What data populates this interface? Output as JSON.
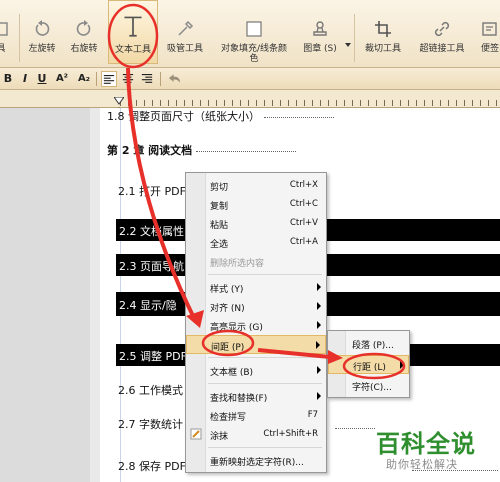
{
  "toolbar": {
    "items": [
      {
        "label": "具",
        "icon": "tool-icon"
      },
      {
        "label": "左旋转",
        "icon": "rotate-left-icon"
      },
      {
        "label": "右旋转",
        "icon": "rotate-right-icon"
      },
      {
        "label": "文本工具",
        "icon": "text-tool-icon"
      },
      {
        "label": "吸管工具",
        "icon": "eyedropper-icon"
      },
      {
        "label": "对象填充/线条颜",
        "label2": "色",
        "icon": "fill-color-icon"
      },
      {
        "label": "图章 (S)",
        "icon": "stamp-icon"
      },
      {
        "label": "裁切工具",
        "icon": "crop-icon"
      },
      {
        "label": "超链接工具",
        "icon": "hyperlink-icon"
      },
      {
        "label": "便签",
        "icon": "note-icon"
      }
    ]
  },
  "formatbar": {
    "bold": "B",
    "italic": "I",
    "underline": "U",
    "superscript": "A²",
    "subscript": "A₂"
  },
  "document": {
    "lines": [
      {
        "text": "1.8 调整页面尺寸（纸张大小）"
      },
      {
        "text": "第 2 章  阅读文档"
      },
      {
        "text": "2.1 打开 PDF"
      },
      {
        "text": "2.2 文档属性"
      },
      {
        "text": "2.3 页面导航"
      },
      {
        "text": "2.4 显示/隐"
      },
      {
        "text": "2.5 调整 PDF"
      },
      {
        "text": "2.6 工作模式"
      },
      {
        "text": "2.7 字数统计"
      },
      {
        "text": "2.8 保存 PDF"
      }
    ]
  },
  "context_menu": {
    "items": [
      {
        "label": "剪切",
        "shortcut": "Ctrl+X"
      },
      {
        "label": "复制",
        "shortcut": "Ctrl+C"
      },
      {
        "label": "粘贴",
        "shortcut": "Ctrl+V"
      },
      {
        "label": "全选",
        "shortcut": "Ctrl+A"
      },
      {
        "label": "删除所选内容",
        "shortcut": ""
      },
      {
        "label": "样式 (Y)",
        "shortcut": ""
      },
      {
        "label": "对齐 (N)",
        "shortcut": ""
      },
      {
        "label": "高亮显示 (G)",
        "shortcut": ""
      },
      {
        "label": "间距 (P)",
        "shortcut": ""
      },
      {
        "label": "文本框 (B)",
        "shortcut": ""
      },
      {
        "label": "查找和替换(F)",
        "shortcut": ""
      },
      {
        "label": "检查拼写",
        "shortcut": "F7"
      },
      {
        "label": "涂抹",
        "shortcut": "Ctrl+Shift+R"
      },
      {
        "label": "重新映射选定字符(R)...",
        "shortcut": ""
      }
    ]
  },
  "submenu": {
    "items": [
      {
        "label": "段落 (P)..."
      },
      {
        "label": "行距 (L)"
      },
      {
        "label": "字符(C)..."
      }
    ]
  },
  "watermark": {
    "title": "百科全说",
    "subtitle": "助你轻松解决"
  },
  "colors": {
    "annotation": "#e8302a",
    "menu_highlight": "#f3dca7",
    "watermark": "#2f8f2f"
  }
}
